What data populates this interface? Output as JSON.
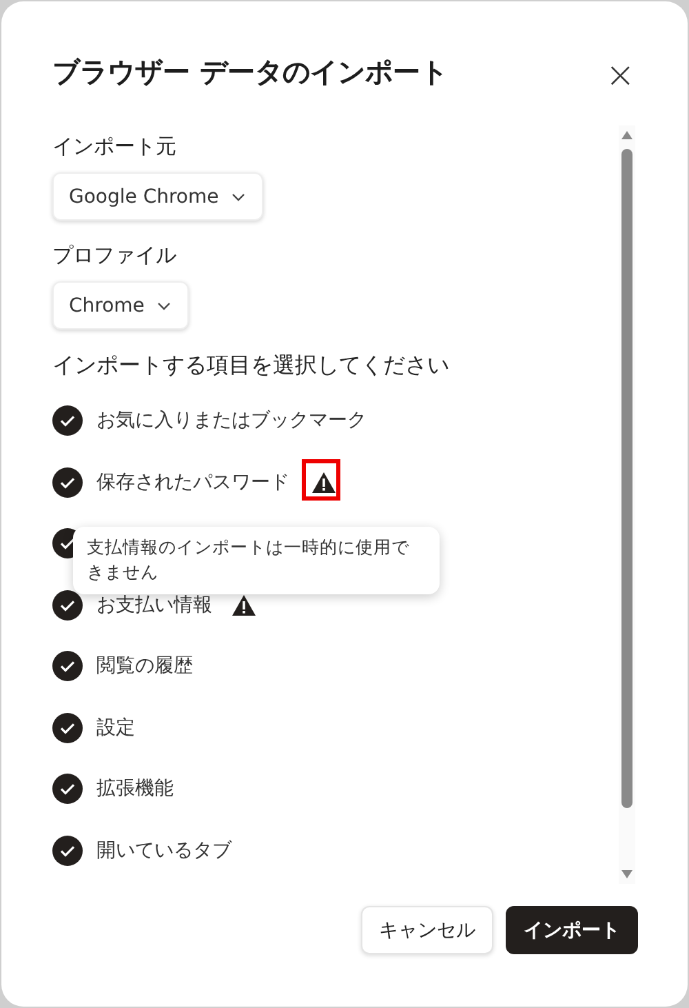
{
  "dialog": {
    "title": "ブラウザー データのインポート",
    "close": "×"
  },
  "source": {
    "label": "インポート元",
    "value": "Google Chrome"
  },
  "profile": {
    "label": "プロファイル",
    "value": "Chrome"
  },
  "items_heading": "インポートする項目を選択してください",
  "items": [
    {
      "label": "お気に入りまたはブックマーク",
      "checked": true,
      "warning": false,
      "highlighted": false
    },
    {
      "label": "保存されたパスワード",
      "checked": true,
      "warning": true,
      "highlighted": true
    },
    {
      "checked": true,
      "warning": false,
      "highlighted": false
    },
    {
      "label": "お支払い情報",
      "checked": true,
      "warning": true,
      "highlighted": false
    },
    {
      "label": "閲覧の履歴",
      "checked": true,
      "warning": false,
      "highlighted": false
    },
    {
      "label": "設定",
      "checked": true,
      "warning": false,
      "highlighted": false
    },
    {
      "label": "拡張機能",
      "checked": true,
      "warning": false,
      "highlighted": false
    },
    {
      "label": "開いているタブ",
      "checked": true,
      "warning": false,
      "highlighted": false
    }
  ],
  "tooltip": "支払情報のインポートは一時的に使用できません",
  "buttons": [
    {
      "label": "キャンセル",
      "kind": "secondary"
    },
    {
      "label": "インポート",
      "kind": "primary"
    }
  ]
}
